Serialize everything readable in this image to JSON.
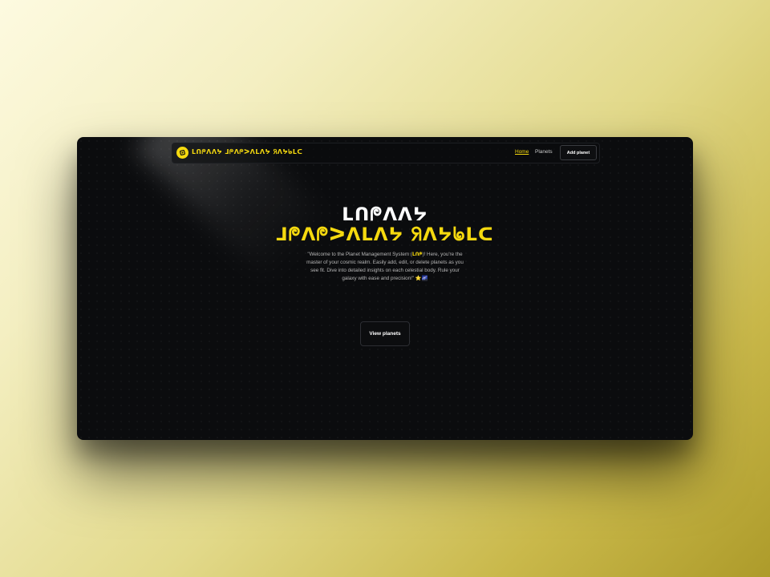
{
  "navbar": {
    "logo_icon": "orbit-logo-icon",
    "brand_text": "ᒪᑎᖘᐱᐱᔭ ᒧᖘᐱᖘᐳᐱᒪᐱᔭ ᖆᐱᔭᖚᒪᑕ",
    "links": [
      {
        "label": "Home",
        "active": true
      },
      {
        "label": "Planets",
        "active": false
      }
    ],
    "add_button_label": "Add planet"
  },
  "hero": {
    "title_line_1": "ᒪᑎᖘᐱᐱᔭ",
    "title_line_2": "ᒧᖘᐱᖘᐳᐱᒪᐱᔭ ᖆᐱᔭᖚᒪᑕ",
    "description_before": "\"Welcome to the Planet Management System (",
    "description_code": "ᒪᑎᖘ",
    "description_after": ")! Here, you're the master of your cosmic realm. Easily add, edit, or delete planets as you see fit. Dive into detailed insights on each celestial body. Rule your galaxy with ease and precision!\" ⭐🌌",
    "cta_label": "View planets"
  },
  "colors": {
    "accent": "#f5d90f",
    "background": "#0b0c0e",
    "text_muted": "#b5b5b5"
  }
}
